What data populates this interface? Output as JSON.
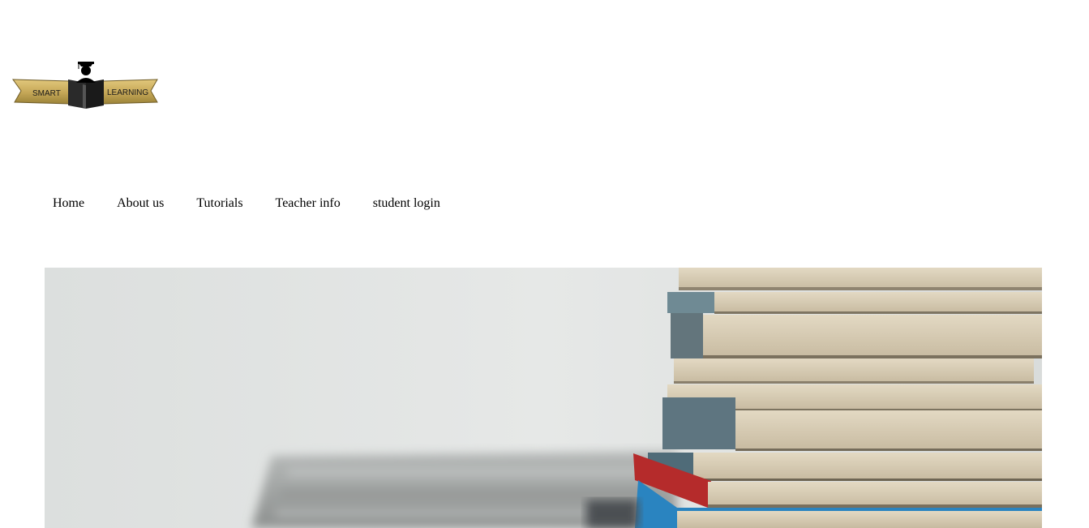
{
  "logo": {
    "left_text": "SMART",
    "right_text": "LEARNING",
    "icon": "graduate-book-icon",
    "colors": {
      "ribbon": "#c8aa5a",
      "ribbon_dark": "#8a7432",
      "book": "#1c1c1c"
    }
  },
  "nav": {
    "items": [
      {
        "label": "Home"
      },
      {
        "label": "About us"
      },
      {
        "label": "Tutorials"
      },
      {
        "label": "Teacher info"
      },
      {
        "label": "student login"
      }
    ]
  },
  "hero": {
    "subject": "stack-of-books-photo",
    "colors": {
      "wall": "#e3e6e5",
      "table": "#9a9d9c",
      "page": "#d8cdb4",
      "cover_blue": "#2a84c0",
      "cover_red": "#b52b2b"
    }
  }
}
